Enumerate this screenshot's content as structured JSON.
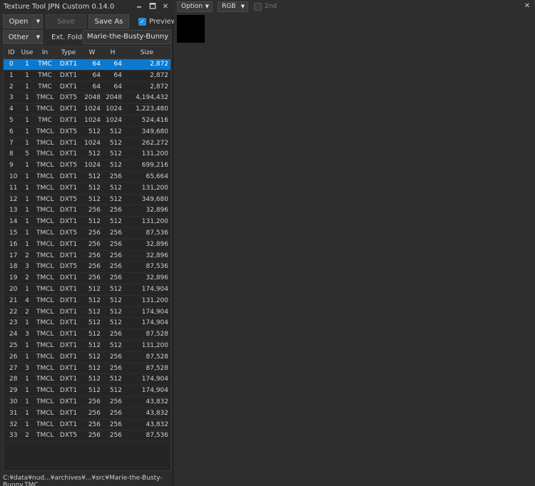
{
  "app": {
    "title": "Texture Tool JPN Custom 0.14.0",
    "minimize_glyph": "🗕",
    "maximize_glyph": "🗖",
    "close_glyph": "✕"
  },
  "toolbar": {
    "open_label": "Open",
    "save_label": "Save",
    "save_as_label": "Save As",
    "preview_label": "Preview",
    "preview_checked": "✓",
    "other_label": "Other",
    "ext_folder_label": "Ext. Folder",
    "ext_folder_value": "Marie-the-Busty-Bunny",
    "dropdown_arrow": "▼"
  },
  "table": {
    "columns": [
      "ID",
      "Use",
      "In",
      "Type",
      "W",
      "H",
      "Size"
    ],
    "rows": [
      [
        "0",
        "1",
        "TMC",
        "DXT1",
        "64",
        "64",
        "2,872"
      ],
      [
        "1",
        "1",
        "TMC",
        "DXT1",
        "64",
        "64",
        "2,872"
      ],
      [
        "2",
        "1",
        "TMC",
        "DXT1",
        "64",
        "64",
        "2,872"
      ],
      [
        "3",
        "1",
        "TMCL",
        "DXT5",
        "2048",
        "2048",
        "4,194,432"
      ],
      [
        "4",
        "1",
        "TMCL",
        "DXT1",
        "1024",
        "1024",
        "1,223,480"
      ],
      [
        "5",
        "1",
        "TMC",
        "DXT1",
        "1024",
        "1024",
        "524,416"
      ],
      [
        "6",
        "1",
        "TMCL",
        "DXT5",
        "512",
        "512",
        "349,680"
      ],
      [
        "7",
        "1",
        "TMCL",
        "DXT1",
        "1024",
        "512",
        "262,272"
      ],
      [
        "8",
        "5",
        "TMCL",
        "DXT1",
        "512",
        "512",
        "131,200"
      ],
      [
        "9",
        "1",
        "TMCL",
        "DXT5",
        "1024",
        "512",
        "699,216"
      ],
      [
        "10",
        "1",
        "TMCL",
        "DXT1",
        "512",
        "256",
        "65,664"
      ],
      [
        "11",
        "1",
        "TMCL",
        "DXT1",
        "512",
        "512",
        "131,200"
      ],
      [
        "12",
        "1",
        "TMCL",
        "DXT5",
        "512",
        "512",
        "349,680"
      ],
      [
        "13",
        "1",
        "TMCL",
        "DXT1",
        "256",
        "256",
        "32,896"
      ],
      [
        "14",
        "1",
        "TMCL",
        "DXT1",
        "512",
        "512",
        "131,200"
      ],
      [
        "15",
        "1",
        "TMCL",
        "DXT5",
        "256",
        "256",
        "87,536"
      ],
      [
        "16",
        "1",
        "TMCL",
        "DXT1",
        "256",
        "256",
        "32,896"
      ],
      [
        "17",
        "2",
        "TMCL",
        "DXT1",
        "256",
        "256",
        "32,896"
      ],
      [
        "18",
        "3",
        "TMCL",
        "DXT5",
        "256",
        "256",
        "87,536"
      ],
      [
        "19",
        "2",
        "TMCL",
        "DXT1",
        "256",
        "256",
        "32,896"
      ],
      [
        "20",
        "1",
        "TMCL",
        "DXT1",
        "512",
        "512",
        "174,904"
      ],
      [
        "21",
        "4",
        "TMCL",
        "DXT1",
        "512",
        "512",
        "131,200"
      ],
      [
        "22",
        "2",
        "TMCL",
        "DXT1",
        "512",
        "512",
        "174,904"
      ],
      [
        "23",
        "1",
        "TMCL",
        "DXT1",
        "512",
        "512",
        "174,904"
      ],
      [
        "24",
        "3",
        "TMCL",
        "DXT1",
        "512",
        "256",
        "87,528"
      ],
      [
        "25",
        "1",
        "TMCL",
        "DXT1",
        "512",
        "512",
        "131,200"
      ],
      [
        "26",
        "1",
        "TMCL",
        "DXT1",
        "512",
        "256",
        "87,528"
      ],
      [
        "27",
        "3",
        "TMCL",
        "DXT1",
        "512",
        "256",
        "87,528"
      ],
      [
        "28",
        "1",
        "TMCL",
        "DXT1",
        "512",
        "512",
        "174,904"
      ],
      [
        "29",
        "1",
        "TMCL",
        "DXT1",
        "512",
        "512",
        "174,904"
      ],
      [
        "30",
        "1",
        "TMCL",
        "DXT1",
        "256",
        "256",
        "43,832"
      ],
      [
        "31",
        "1",
        "TMCL",
        "DXT1",
        "256",
        "256",
        "43,832"
      ],
      [
        "32",
        "1",
        "TMCL",
        "DXT1",
        "256",
        "256",
        "43,832"
      ],
      [
        "33",
        "2",
        "TMCL",
        "DXT5",
        "256",
        "256",
        "87,536"
      ]
    ],
    "selected_index": 0
  },
  "status": {
    "path": "C:¥data¥nud...¥archives¥...¥src¥Marie-the-Busty-Bunny.TMC"
  },
  "viewer": {
    "option_label": "Option",
    "channel_label": "RGB",
    "second_label": "2nd",
    "close_glyph": "✕",
    "dropdown_arrow": "▼"
  },
  "colors": {
    "accent": "#0b79cf",
    "check_accent": "#1f8fe0"
  }
}
